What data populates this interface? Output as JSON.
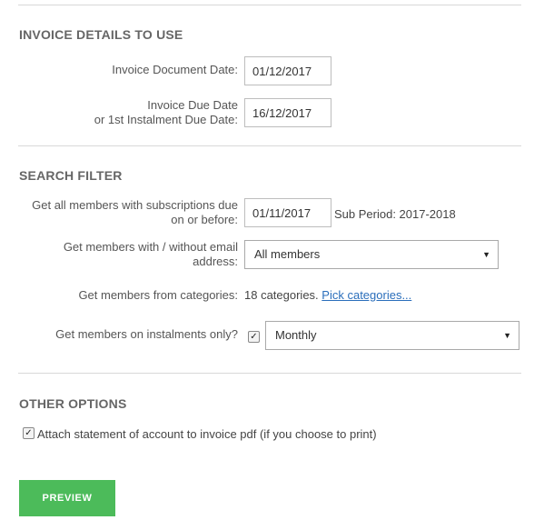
{
  "invoice_details": {
    "title": "INVOICE DETAILS TO USE",
    "document_date_label": "Invoice Document Date:",
    "document_date_value": "01/12/2017",
    "due_date_label_line1": "Invoice Due Date",
    "due_date_label_line2": "or 1st Instalment Due Date:",
    "due_date_value": "16/12/2017"
  },
  "search_filter": {
    "title": "SEARCH FILTER",
    "subs_due_label_line1": "Get all members with subscriptions due",
    "subs_due_label_line2": "on or before:",
    "subs_due_value": "01/11/2017",
    "sub_period_text": "Sub Period: 2017-2018",
    "email_label_line1": "Get members with / without email",
    "email_label_line2": "address:",
    "email_selected": "All members",
    "categories_label": "Get members from categories:",
    "categories_count": "18 categories.",
    "categories_link": "Pick categories...",
    "instalments_label": "Get members on instalments only?",
    "instalments_checked": true,
    "instalments_selected": "Monthly"
  },
  "other_options": {
    "title": "OTHER OPTIONS",
    "attach_statement_checked": true,
    "attach_statement_label": "Attach statement of account to invoice pdf (if you choose to print)"
  },
  "actions": {
    "preview_label": "PREVIEW"
  },
  "colors": {
    "preview_button": "#4cbb5a",
    "link": "#2a6ebb",
    "divider": "#d8d8d8"
  },
  "icons": {
    "select_caret": "caret-down-icon",
    "checkbox_mark": "check-icon"
  }
}
